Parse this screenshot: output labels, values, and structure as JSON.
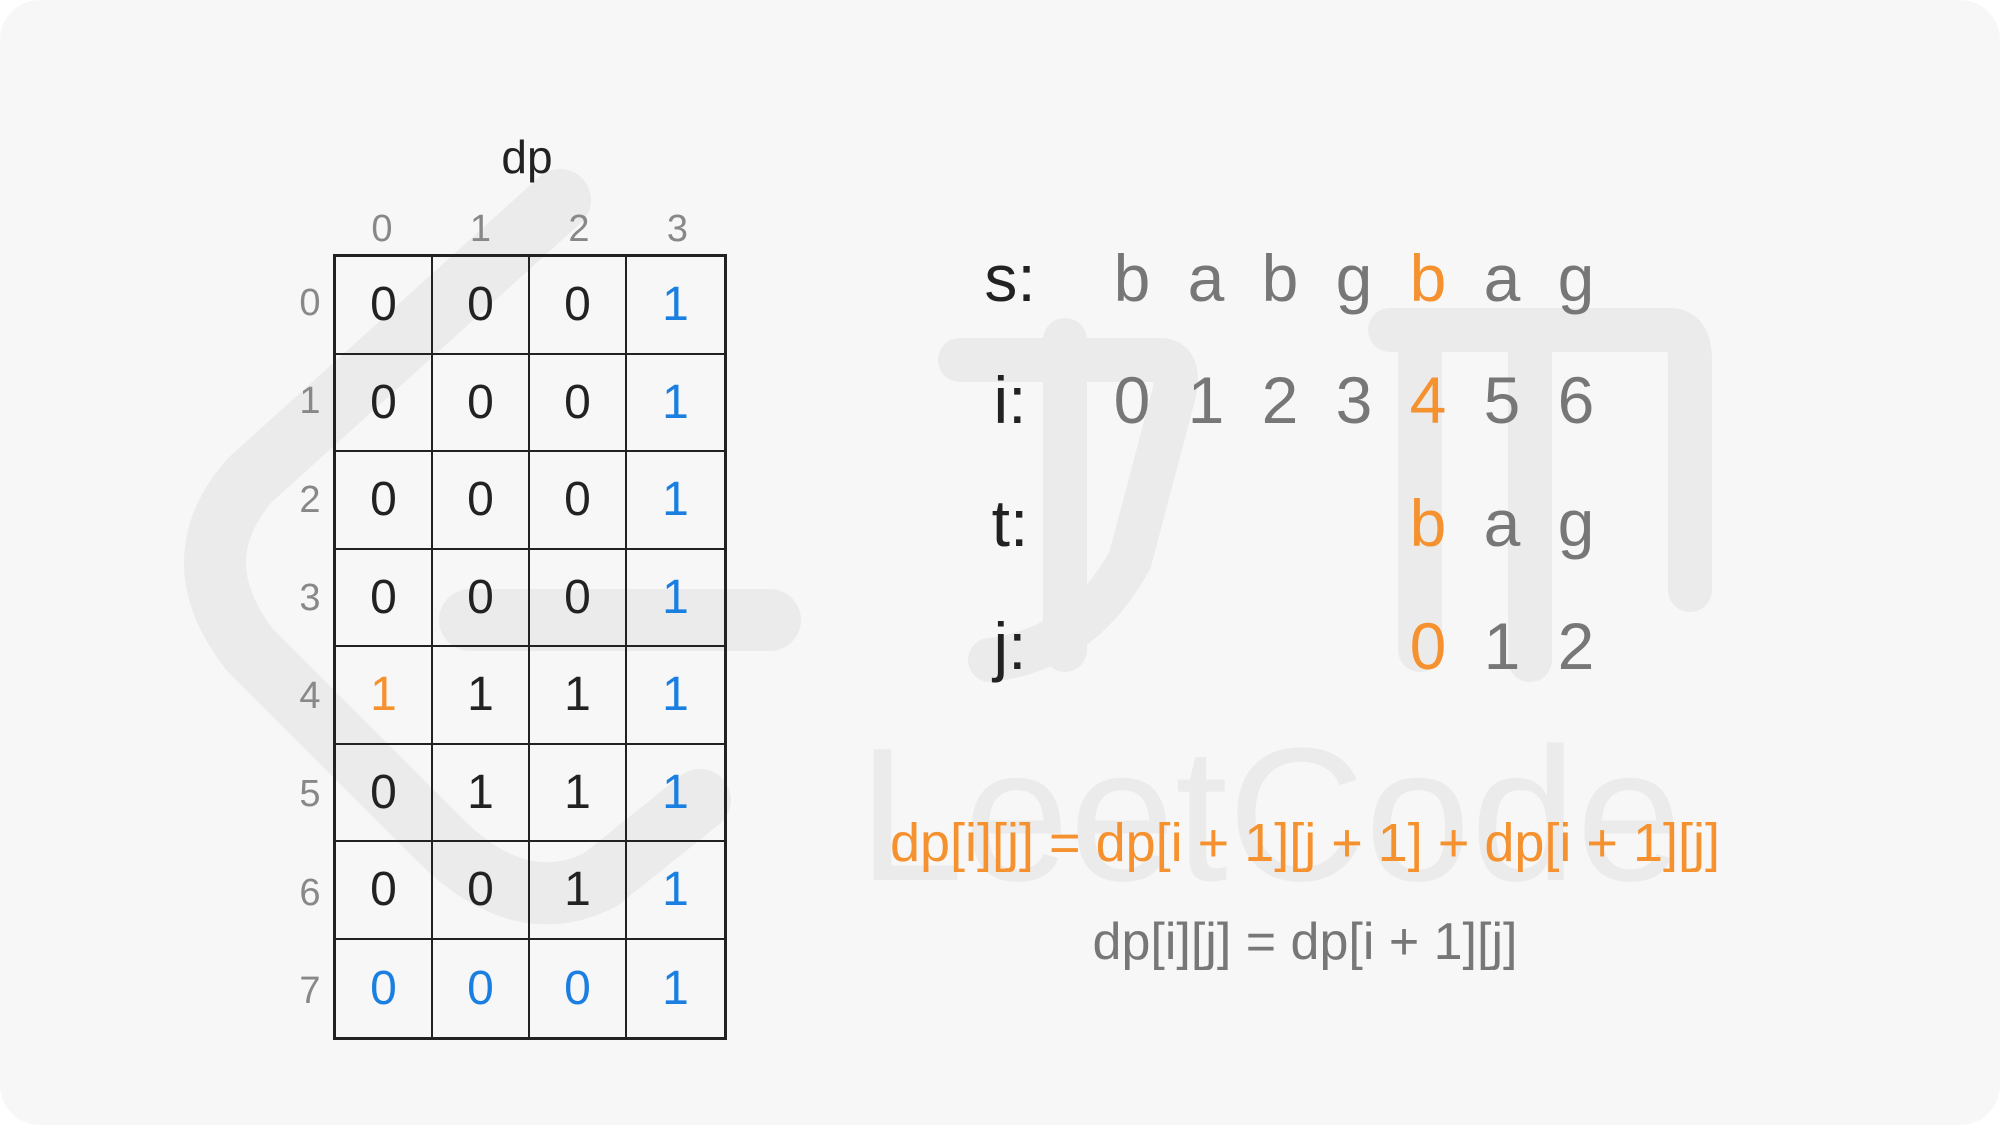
{
  "colors": {
    "default": "#222222",
    "index": "#888888",
    "muted": "#777777",
    "orange": "#f5922f",
    "blue": "#1a7fe0"
  },
  "table": {
    "title": "dp",
    "col_indices": [
      "0",
      "1",
      "2",
      "3"
    ],
    "row_indices": [
      "0",
      "1",
      "2",
      "3",
      "4",
      "5",
      "6",
      "7"
    ],
    "rows": [
      [
        {
          "v": "0",
          "c": "default"
        },
        {
          "v": "0",
          "c": "default"
        },
        {
          "v": "0",
          "c": "default"
        },
        {
          "v": "1",
          "c": "blue"
        }
      ],
      [
        {
          "v": "0",
          "c": "default"
        },
        {
          "v": "0",
          "c": "default"
        },
        {
          "v": "0",
          "c": "default"
        },
        {
          "v": "1",
          "c": "blue"
        }
      ],
      [
        {
          "v": "0",
          "c": "default"
        },
        {
          "v": "0",
          "c": "default"
        },
        {
          "v": "0",
          "c": "default"
        },
        {
          "v": "1",
          "c": "blue"
        }
      ],
      [
        {
          "v": "0",
          "c": "default"
        },
        {
          "v": "0",
          "c": "default"
        },
        {
          "v": "0",
          "c": "default"
        },
        {
          "v": "1",
          "c": "blue"
        }
      ],
      [
        {
          "v": "1",
          "c": "orange"
        },
        {
          "v": "1",
          "c": "default"
        },
        {
          "v": "1",
          "c": "default"
        },
        {
          "v": "1",
          "c": "blue"
        }
      ],
      [
        {
          "v": "0",
          "c": "default"
        },
        {
          "v": "1",
          "c": "default"
        },
        {
          "v": "1",
          "c": "default"
        },
        {
          "v": "1",
          "c": "blue"
        }
      ],
      [
        {
          "v": "0",
          "c": "default"
        },
        {
          "v": "0",
          "c": "default"
        },
        {
          "v": "1",
          "c": "default"
        },
        {
          "v": "1",
          "c": "blue"
        }
      ],
      [
        {
          "v": "0",
          "c": "blue"
        },
        {
          "v": "0",
          "c": "blue"
        },
        {
          "v": "0",
          "c": "blue"
        },
        {
          "v": "1",
          "c": "blue"
        }
      ]
    ]
  },
  "sequences": [
    {
      "name": "s",
      "label": "s:",
      "start": 0,
      "chars": [
        {
          "v": "b",
          "c": "muted"
        },
        {
          "v": "a",
          "c": "muted"
        },
        {
          "v": "b",
          "c": "muted"
        },
        {
          "v": "g",
          "c": "muted"
        },
        {
          "v": "b",
          "c": "orange"
        },
        {
          "v": "a",
          "c": "muted"
        },
        {
          "v": "g",
          "c": "muted"
        }
      ]
    },
    {
      "name": "i",
      "label": "i:",
      "start": 0,
      "chars": [
        {
          "v": "0",
          "c": "muted"
        },
        {
          "v": "1",
          "c": "muted"
        },
        {
          "v": "2",
          "c": "muted"
        },
        {
          "v": "3",
          "c": "muted"
        },
        {
          "v": "4",
          "c": "orange"
        },
        {
          "v": "5",
          "c": "muted"
        },
        {
          "v": "6",
          "c": "muted"
        }
      ]
    },
    {
      "name": "t",
      "label": "t:",
      "start": 4,
      "chars": [
        {
          "v": "b",
          "c": "orange"
        },
        {
          "v": "a",
          "c": "muted"
        },
        {
          "v": "g",
          "c": "muted"
        }
      ]
    },
    {
      "name": "j",
      "label": "j:",
      "start": 4,
      "chars": [
        {
          "v": "0",
          "c": "orange"
        },
        {
          "v": "1",
          "c": "muted"
        },
        {
          "v": "2",
          "c": "muted"
        }
      ]
    }
  ],
  "formulas": {
    "primary": "dp[i][j] = dp[i + 1][j + 1] + dp[i + 1][j]",
    "secondary": "dp[i][j] = dp[i + 1][j]"
  },
  "watermark": {
    "text": "LeetCode",
    "icon": "leetcode-logo-icon"
  }
}
